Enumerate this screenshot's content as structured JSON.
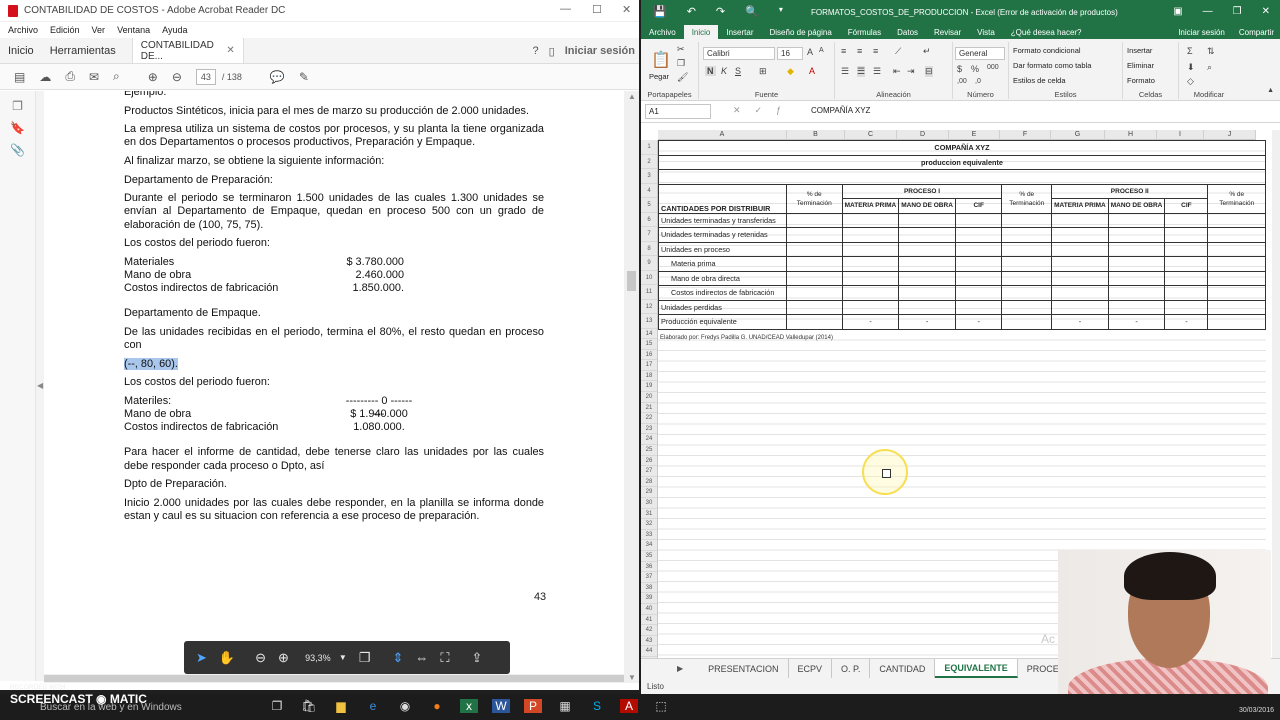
{
  "acrobat": {
    "window_title": "CONTABILIDAD DE COSTOS - Adobe Acrobat Reader DC",
    "menu": [
      "Archivo",
      "Edición",
      "Ver",
      "Ventana",
      "Ayuda"
    ],
    "tabs": {
      "home": "Inicio",
      "tools": "Herramientas",
      "doc": "CONTABILIDAD DE...",
      "signin": "Iniciar sesión"
    },
    "page_current": "43",
    "page_total": "/ 138",
    "zoom": "93,3%",
    "page_number": "43",
    "content": {
      "p0": "Ejemplo:",
      "p1": "Productos Sintéticos, inicia para el mes de marzo su producción de 2.000 unidades.",
      "p2": "La empresa utiliza un sistema de costos por procesos, y su planta la tiene organizada en dos Departamentos o procesos productivos, Preparación y Empaque.",
      "p3": "Al finalizar marzo, se obtiene la siguiente información:",
      "p4": "Departamento de Preparación:",
      "p5": "Durante el periodo se terminaron 1.500 unidades de las cuales 1.300 unidades se envían al Departamento de Empaque, quedan en proceso 500 con un grado de elaboración de (100, 75, 75).",
      "p6": "Los costos del periodo fueron:",
      "costs1": [
        {
          "label": "Materiales",
          "value": "$ 3.780.000"
        },
        {
          "label": "Mano de obra",
          "value": "2.460.000"
        },
        {
          "label": "Costos indirectos de fabricación",
          "value": "1.850.000."
        }
      ],
      "p7": "Departamento de Empaque.",
      "p8": "De las unidades recibidas en el periodo, termina el 80%, el resto quedan en proceso con",
      "p9": "(--, 80, 60).",
      "p10": "Los costos del periodo fueron:",
      "costs2": [
        {
          "label": "Materiles:",
          "value": "--------- 0 ---------"
        },
        {
          "label": "Mano de obra",
          "value": "$ 1.940.000"
        },
        {
          "label": "Costos indirectos de fabricación",
          "value": "1.080.000."
        }
      ],
      "p11": "Para hacer el informe de cantidad, debe tenerse claro las unidades por las cuales debe responder cada proceso o Dpto, así",
      "p12": "Dpto de Preparación.",
      "p13": "Inicio 2.000 unidades por las cuales debe responder, en la planilla se informa donde estan y caul es su situacion con referencia a ese proceso de preparación."
    }
  },
  "excel": {
    "window_title": "FORMATOS_COSTOS_DE_PRODUCCION - Excel (Error de activación de productos)",
    "tabs": [
      "Archivo",
      "Inicio",
      "Insertar",
      "Diseño de página",
      "Fórmulas",
      "Datos",
      "Revisar",
      "Vista",
      "¿Qué desea hacer?"
    ],
    "signin": "Iniciar sesión",
    "share": "Compartir",
    "font_name": "Calibri",
    "font_size": "16",
    "number_format": "General",
    "ribbon_items": {
      "paste": "Pegar",
      "cond_format": "Formato condicional",
      "table_format": "Dar formato como tabla",
      "cell_styles": "Estilos de celda",
      "insert": "Insertar",
      "delete": "Eliminar",
      "format": "Formato"
    },
    "ribbon_groups": [
      "Portapapeles",
      "Fuente",
      "Alineación",
      "Número",
      "Estilos",
      "Celdas",
      "Modificar"
    ],
    "name_box": "A1",
    "formula": "COMPAÑÍA XYZ",
    "columns": [
      "A",
      "B",
      "C",
      "D",
      "E",
      "F",
      "G",
      "H",
      "I",
      "J"
    ],
    "rows": [
      "1",
      "2",
      "3",
      "4",
      "5",
      "6",
      "7",
      "8",
      "9",
      "10",
      "11",
      "12",
      "13",
      "14",
      "15",
      "16",
      "17",
      "18",
      "19",
      "20",
      "21",
      "22",
      "23",
      "24",
      "25",
      "26",
      "27",
      "28",
      "29",
      "30",
      "31",
      "32",
      "33",
      "34",
      "35",
      "36",
      "37",
      "38",
      "39",
      "40",
      "41",
      "42",
      "43",
      "44",
      "45"
    ],
    "sheet": {
      "company": "COMPAÑÍA XYZ",
      "subtitle": "produccion equivalente",
      "proc1": "PROCESO I",
      "proc2": "PROCESO II",
      "pct": "% de",
      "term": "Terminación",
      "cant": "CANTIDADES POR DISTRIBUIR",
      "mp": "MATERIA PRIMA",
      "mo": "MANO DE OBRA",
      "cif": "CIF",
      "ma": "MA",
      "rows": [
        "Unidades terminadas y transferidas",
        "Unidades terminadas y retenidas",
        "Unidades en proceso",
        "Materia prima",
        "Mano de obra directa",
        "Costos indirectos de fabricación",
        "Unidades perdidas",
        "Producción equivalente"
      ],
      "dash": "-",
      "note": "Elaborado por: Fredys Padilla G. UNAD/CEAD Valledupar (2014)"
    },
    "sheets": [
      "PRESENTACION",
      "ECPV",
      "O. P.",
      "CANTIDAD",
      "EQUIVALENTE",
      "PROCESO"
    ],
    "active_sheet": "EQUIVALENTE",
    "status": "Listo",
    "activate_text": "Ac"
  },
  "taskbar": {
    "search": "Buscar en la web y en Windows",
    "date": "30/03/2016"
  },
  "watermark": {
    "small": "RECORDED WITH",
    "big": "SCREENCAST ◉ MATIC"
  }
}
